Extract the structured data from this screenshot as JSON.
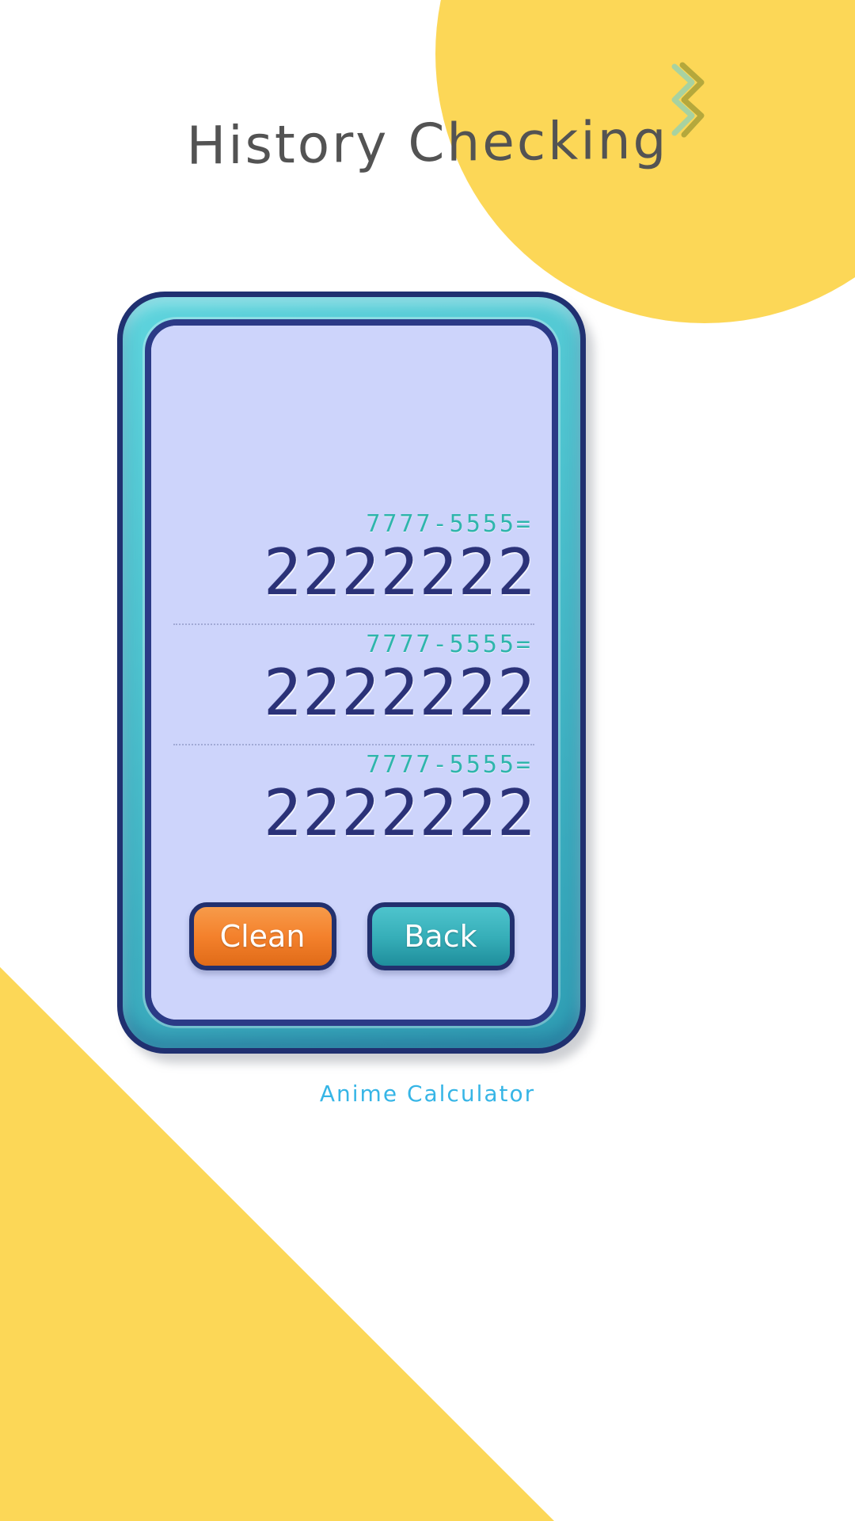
{
  "app": {
    "title": "History Checking",
    "brand": "Anime Calculator"
  },
  "colors": {
    "background": "#ffffff",
    "accent_yellow": "#fcd757",
    "title_gray": "#535353",
    "device_teal": "#4ec3cf",
    "device_border_navy": "#203070",
    "screen_lavender": "#cdd4fb",
    "expression_teal": "#2fb5ac",
    "result_navy": "#2b3278",
    "clean_orange": "#f4812c",
    "back_teal": "#36aeb8",
    "brand_blue": "#36b5e6",
    "zigzag_olive": "#b5a83c",
    "zigzag_green": "#a8d2a0"
  },
  "screen": {
    "history": [
      {
        "expression": "7777-5555=",
        "result": "2222222"
      },
      {
        "expression": "7777-5555=",
        "result": "2222222"
      },
      {
        "expression": "7777-5555=",
        "result": "2222222"
      }
    ]
  },
  "buttons": {
    "clean_label": "Clean",
    "back_label": "Back"
  },
  "decorations": {
    "circle_top_right": "yellow-circle",
    "triangle_bottom_left": "yellow-triangle",
    "zigzag": "zigzag-decoration"
  }
}
